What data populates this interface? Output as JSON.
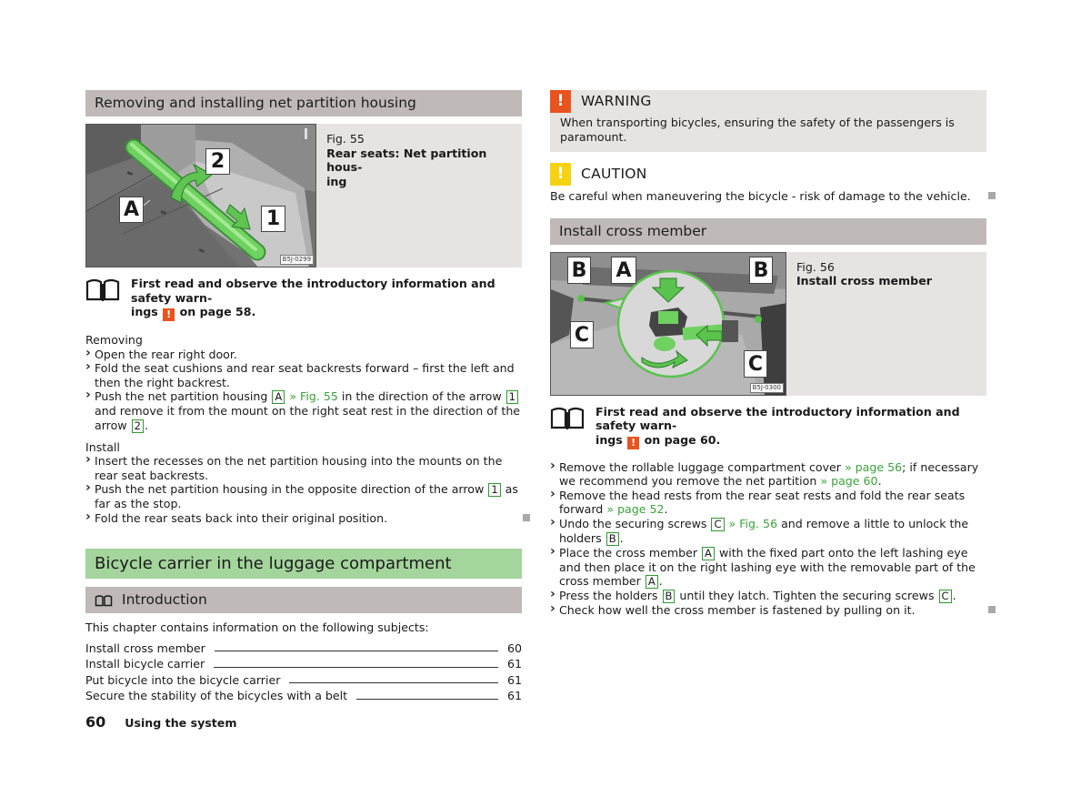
{
  "left": {
    "section_title": "Removing and installing net partition housing",
    "figure": {
      "number": "Fig. 55",
      "title": "Rear seats: Net partition housing",
      "title_lines": [
        "Rear seats: Net partition hous-",
        "ing"
      ],
      "code": "B5J-0299",
      "labels": {
        "a": "A",
        "one": "1",
        "two": "2"
      }
    },
    "notice": {
      "line1": "First read and observe the introductory information and safety warn-",
      "pre": "ings",
      "post": "on page 58.",
      "mark": "!"
    },
    "removing": {
      "heading": "Removing",
      "steps": [
        {
          "text": "Open the rear right door."
        },
        {
          "text": "Fold the seat cushions and rear seat backrests forward – first the left and then the right backrest."
        },
        {
          "t1": "Push the net partition housing",
          "box1": "A",
          "link": "» Fig. 55",
          "t2": "in the direction of the arrow",
          "box2": "1",
          "t3": "and remove it from the mount on the right seat rest in the direction of the arrow",
          "box3": "2",
          "t4": "."
        }
      ]
    },
    "install": {
      "heading": "Install",
      "steps": [
        {
          "text": "Insert the recesses on the net partition housing into the mounts on the rear seat backrests."
        },
        {
          "t1": "Push the net partition housing in the opposite direction of the arrow",
          "box1": "1",
          "t2": "as far as the stop."
        },
        {
          "text": "Fold the rear seats back into their original position."
        }
      ]
    },
    "chapter_title": "Bicycle carrier in the luggage compartment",
    "intro_title": "Introduction",
    "intro_text": "This chapter contains information on the following subjects:",
    "toc": [
      {
        "label": "Install cross member",
        "page": "60"
      },
      {
        "label": "Install bicycle carrier",
        "page": "61"
      },
      {
        "label": "Put bicycle into the bicycle carrier",
        "page": "61"
      },
      {
        "label": "Secure the stability of the bicycles with a belt",
        "page": "61"
      }
    ]
  },
  "right": {
    "warning": {
      "title": "WARNING",
      "icon": "!",
      "color": "#e8541e",
      "text": "When transporting bicycles, ensuring the safety of the passengers is paramount."
    },
    "caution": {
      "title": "CAUTION",
      "icon": "!",
      "color": "#f6d312",
      "text": "Be careful when maneuvering the bicycle - risk of damage to the vehicle."
    },
    "section_title": "Install cross member",
    "figure": {
      "number": "Fig. 56",
      "title": "Install cross member",
      "code": "B5J-0300",
      "labels": {
        "b": "B",
        "a": "A",
        "c": "C"
      }
    },
    "notice": {
      "line1": "First read and observe the introductory information and safety warn-",
      "pre": "ings",
      "post": "on page 60.",
      "mark": "!"
    },
    "steps": [
      {
        "t1": "Remove the rollable luggage compartment cover",
        "link1": "» page 56",
        "t2": "; if necessary we recommend you remove the net partition",
        "link2": "» page 60",
        "t3": "."
      },
      {
        "t1": "Remove the head rests from the rear seat rests and fold the rear seats forward",
        "link1": "» page 52",
        "t2": "."
      },
      {
        "t1": "Undo the securing screws",
        "box1": "C",
        "link1": "» Fig. 56",
        "t2": "and remove a little to unlock the holders",
        "box2": "B",
        "t3": "."
      },
      {
        "t1": "Place the cross member",
        "box1": "A",
        "t2": "with the fixed part onto the left lashing eye and then place it on the right lashing eye with the removable part of the cross member",
        "box2": "A",
        "t3": "."
      },
      {
        "t1": "Press the holders",
        "box1": "B",
        "t2": "until they latch. Tighten the securing screws",
        "box2": "C",
        "t3": "."
      },
      {
        "t1": "Check how well the cross member is fastened by pulling on it."
      }
    ]
  },
  "footer": {
    "page_number": "60",
    "section": "Using the system"
  },
  "colors": {
    "section_bar": "#bfb9b7",
    "chapter_bar": "#a4d59c",
    "link_green": "#39a43a",
    "warning_orange": "#e8541e",
    "caution_yellow": "#f6d312"
  }
}
